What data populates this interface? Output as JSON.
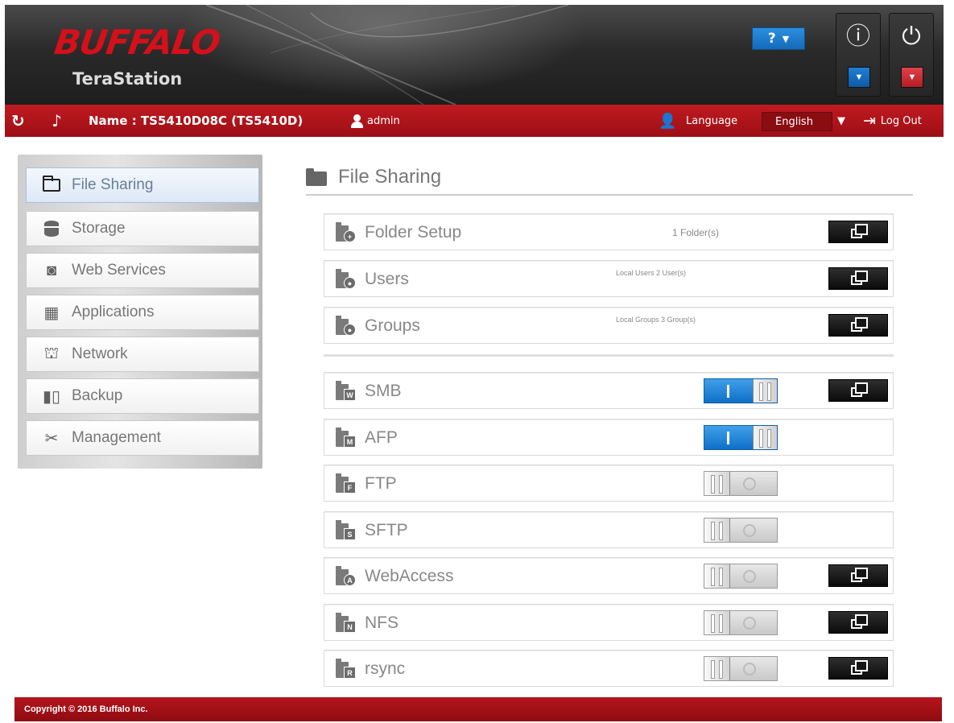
{
  "header": {
    "logo": "BUFFALO",
    "product": "TeraStation",
    "help_label": "?",
    "info_icon": "info-icon",
    "power_icon": "power-icon"
  },
  "topbar": {
    "name": "Name : TS5410D08C (TS5410D)",
    "user": "admin",
    "language_label": "Language",
    "language_value": "English",
    "logout_label": "Log Out"
  },
  "sidebar": {
    "items": [
      {
        "label": "File Sharing",
        "icon": "folder-icon",
        "active": true
      },
      {
        "label": "Storage",
        "icon": "database-icon"
      },
      {
        "label": "Web Services",
        "icon": "web-services-icon"
      },
      {
        "label": "Applications",
        "icon": "applications-icon"
      },
      {
        "label": "Network",
        "icon": "network-icon"
      },
      {
        "label": "Backup",
        "icon": "backup-icon"
      },
      {
        "label": "Management",
        "icon": "tools-icon"
      }
    ]
  },
  "main": {
    "title": "File Sharing",
    "rows": [
      {
        "label": "Folder Setup",
        "info": "1 Folder(s)",
        "icon": "folder-setup-icon",
        "open": true
      },
      {
        "label": "Users",
        "info": "Local Users 2 User(s)",
        "icon": "users-icon",
        "open": true
      },
      {
        "label": "Groups",
        "info": "Local Groups 3 Group(s)",
        "icon": "groups-icon",
        "open": true
      },
      {
        "label": "SMB",
        "icon": "smb-icon",
        "badge": "W",
        "toggle": "on",
        "open": true
      },
      {
        "label": "AFP",
        "icon": "afp-icon",
        "badge": "M",
        "toggle": "on",
        "open": false
      },
      {
        "label": "FTP",
        "icon": "ftp-icon",
        "badge": "F",
        "toggle": "off",
        "open": false
      },
      {
        "label": "SFTP",
        "icon": "sftp-icon",
        "badge": "S",
        "toggle": "off",
        "open": false
      },
      {
        "label": "WebAccess",
        "icon": "webaccess-icon",
        "badge": "A",
        "toggle": "off",
        "open": true
      },
      {
        "label": "NFS",
        "icon": "nfs-icon",
        "badge": "N",
        "toggle": "off",
        "open": true
      },
      {
        "label": "rsync",
        "icon": "rsync-icon",
        "badge": "R",
        "toggle": "off",
        "open": true
      }
    ]
  },
  "footer": {
    "copyright": "Copyright © 2016 Buffalo Inc."
  },
  "colors": {
    "brand_red": "#c01a21",
    "toggle_on": "#1f82d8",
    "header_dark": "#262626"
  }
}
